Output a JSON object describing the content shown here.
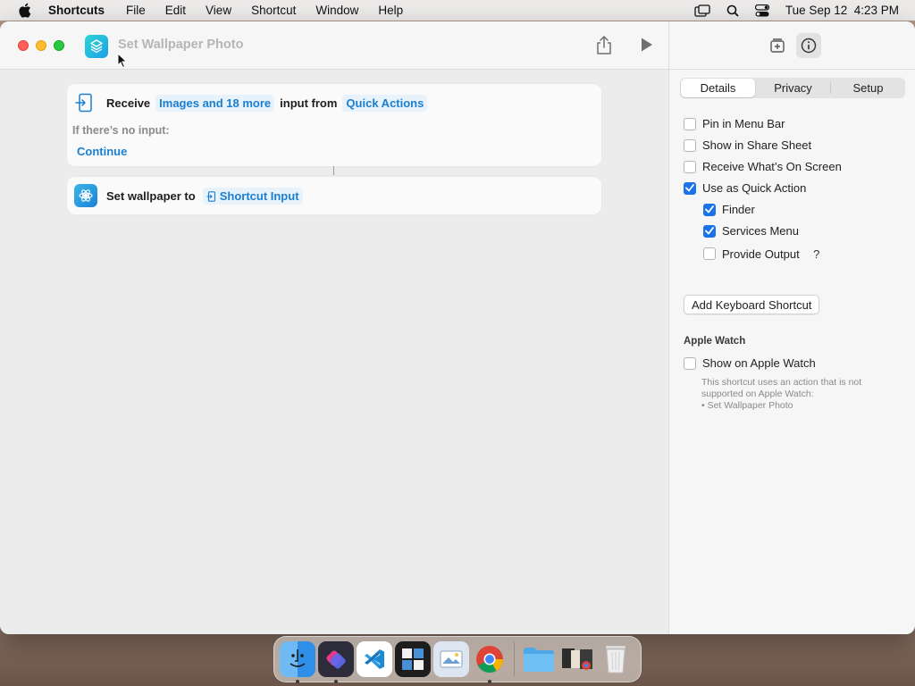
{
  "menubar": {
    "app_name": "Shortcuts",
    "items": [
      "File",
      "Edit",
      "View",
      "Shortcut",
      "Window",
      "Help"
    ],
    "datetime": "Tue Sep 12  4:23 PM",
    "icons": [
      "apple-icon",
      "screen-mirroring-icon",
      "spotlight-search-icon",
      "control-center-icon"
    ]
  },
  "window": {
    "title": "Set Wallpaper Photo"
  },
  "editor": {
    "receive_action": {
      "verb": "Receive",
      "input_types": "Images and 18 more",
      "middle": "input from",
      "source": "Quick Actions",
      "no_input_label": "If there’s no input:",
      "no_input_value": "Continue"
    },
    "wallpaper_action": {
      "label": "Set wallpaper to",
      "variable": "Shortcut Input"
    }
  },
  "details_panel": {
    "tabs": [
      "Details",
      "Privacy",
      "Setup"
    ],
    "active_tab": "Details",
    "options": [
      {
        "label": "Pin in Menu Bar",
        "checked": false
      },
      {
        "label": "Show in Share Sheet",
        "checked": false
      },
      {
        "label": "Receive What’s On Screen",
        "checked": false
      },
      {
        "label": "Use as Quick Action",
        "checked": true
      }
    ],
    "quick_action_sub": [
      {
        "label": "Finder",
        "checked": true
      },
      {
        "label": "Services Menu",
        "checked": true
      },
      {
        "label": "Provide Output",
        "checked": false
      }
    ],
    "help_label": "?",
    "keyboard_button": "Add Keyboard Shortcut",
    "apple_watch": {
      "section": "Apple Watch",
      "option": {
        "label": "Show on Apple Watch",
        "checked": false
      },
      "note_line1": "This shortcut uses an action that is not",
      "note_line2": "supported on Apple Watch:",
      "note_line3": "• Set Wallpaper Photo"
    }
  },
  "dock": {
    "apps": [
      "finder",
      "shortcuts",
      "vscode",
      "photo-booth",
      "preview",
      "chrome",
      "folder",
      "screenshots",
      "trash"
    ]
  }
}
